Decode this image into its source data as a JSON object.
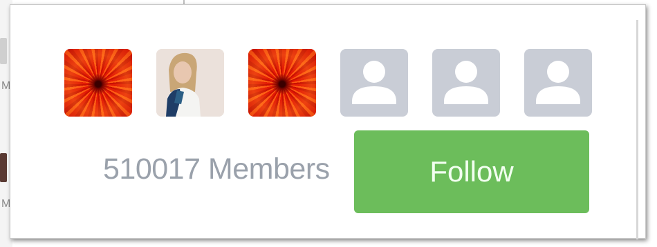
{
  "background": {
    "left_letters": [
      "M",
      "M"
    ]
  },
  "card": {
    "avatars": [
      {
        "kind": "flower",
        "icon": "flower-photo"
      },
      {
        "kind": "photo",
        "icon": "person-photo"
      },
      {
        "kind": "flower",
        "icon": "flower-photo"
      },
      {
        "kind": "default",
        "icon": "default-user-icon"
      },
      {
        "kind": "default",
        "icon": "default-user-icon"
      },
      {
        "kind": "default",
        "icon": "default-user-icon"
      }
    ],
    "members_text": "510017 Members",
    "follow_label": "Follow"
  },
  "colors": {
    "follow_green": "#6cbd5b",
    "placeholder_gray": "#c9cdd6",
    "members_text": "#9aa1ab"
  }
}
